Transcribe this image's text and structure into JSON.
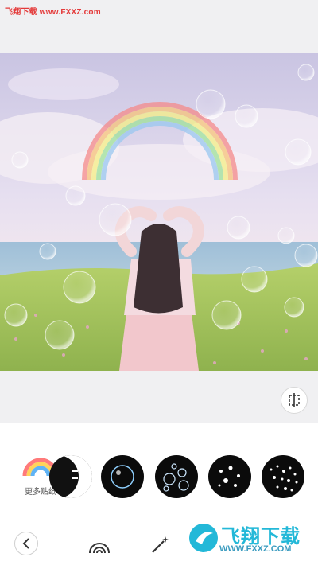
{
  "watermark_top": "飞翔下载 www.FXXZ.com",
  "sticker_panel": {
    "more_label": "更多贴纸",
    "items": [
      {
        "name": "sticker-pack-partial-black"
      },
      {
        "name": "sticker-pack-single-bubble"
      },
      {
        "name": "sticker-pack-bubbles"
      },
      {
        "name": "sticker-pack-sparkle-bubbles"
      },
      {
        "name": "sticker-pack-dense-bubbles"
      }
    ]
  },
  "toolbar": {
    "back_icon": "chevron-left-icon",
    "tools": [
      "rainbow-icon",
      "magic-wand-icon"
    ]
  },
  "watermark_badge": {
    "title": "飞翔下载",
    "url": "WWW.FXXZ.COM"
  },
  "colors": {
    "background": "#f0f0f2",
    "panel": "#ffffff",
    "watermark_red": "#e43a3a",
    "watermark_blue": "#23b8d8"
  }
}
